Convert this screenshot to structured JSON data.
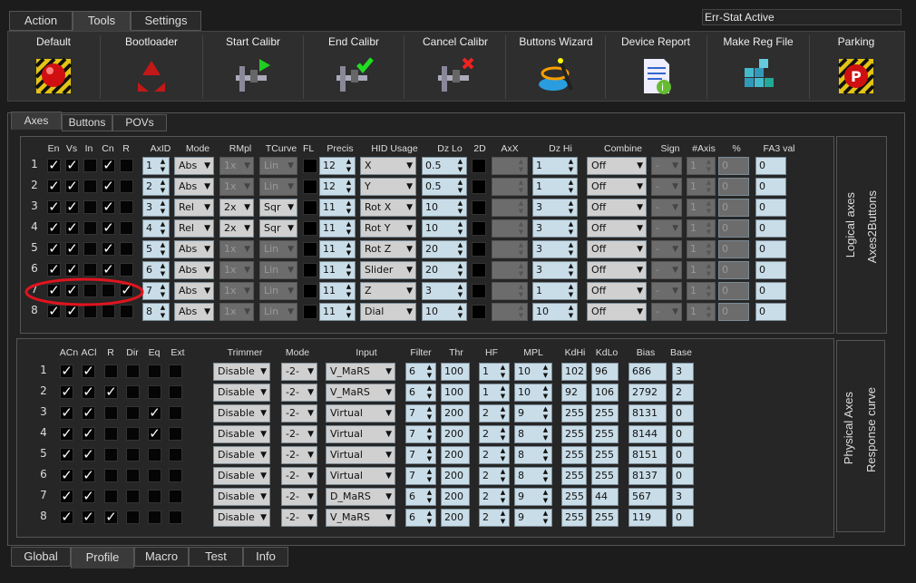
{
  "top_tabs": [
    "Action",
    "Tools",
    "Settings"
  ],
  "status": "Err-Stat Active",
  "toolbar": [
    {
      "label": "Default",
      "icon": "red-button-icon"
    },
    {
      "label": "Bootloader",
      "icon": "recycle-icon"
    },
    {
      "label": "Start Calibr",
      "icon": "caliper-play-icon"
    },
    {
      "label": "End Calibr",
      "icon": "caliper-check-icon"
    },
    {
      "label": "Cancel Calibr",
      "icon": "caliper-cancel-icon"
    },
    {
      "label": "Buttons Wizard",
      "icon": "wizard-icon"
    },
    {
      "label": "Device Report",
      "icon": "report-icon"
    },
    {
      "label": "Make Reg File",
      "icon": "registry-icon"
    },
    {
      "label": "Parking",
      "icon": "parking-icon"
    }
  ],
  "sub_tabs": [
    "Axes",
    "Buttons",
    "POVs"
  ],
  "logical_headers": [
    "En",
    "Vs",
    "In",
    "Cn",
    "R",
    "AxID",
    "Mode",
    "RMpl",
    "TCurve",
    "FL",
    "Precis",
    "HID Usage",
    "Dz Lo",
    "2D",
    "AxX",
    "Dz Hi",
    "Combine",
    "Sign",
    "#Axis",
    "%",
    "FA3 val"
  ],
  "logical_side": [
    "Logical axes",
    "Axes2Buttons"
  ],
  "logical_rows": [
    {
      "n": "1",
      "en": true,
      "vs": true,
      "in": false,
      "cn": true,
      "r": false,
      "axid": "1",
      "mode": "Abs",
      "rmpl": "1x",
      "tcurve": "Lin",
      "precis": "12",
      "hid": "X",
      "dzlo": "0.5",
      "dzhi": "1",
      "combine": "Off",
      "sign": "-",
      "naxis": "1",
      "pct": "0",
      "fa3": "0"
    },
    {
      "n": "2",
      "en": true,
      "vs": true,
      "in": false,
      "cn": true,
      "r": false,
      "axid": "2",
      "mode": "Abs",
      "rmpl": "1x",
      "tcurve": "Lin",
      "precis": "12",
      "hid": "Y",
      "dzlo": "0.5",
      "dzhi": "1",
      "combine": "Off",
      "sign": "-",
      "naxis": "1",
      "pct": "0",
      "fa3": "0"
    },
    {
      "n": "3",
      "en": true,
      "vs": true,
      "in": false,
      "cn": true,
      "r": false,
      "axid": "3",
      "mode": "Rel",
      "rmpl": "2x",
      "tcurve": "Sqr",
      "precis": "11",
      "hid": "Rot X",
      "dzlo": "10",
      "dzhi": "3",
      "combine": "Off",
      "sign": "-",
      "naxis": "1",
      "pct": "0",
      "fa3": "0"
    },
    {
      "n": "4",
      "en": true,
      "vs": true,
      "in": false,
      "cn": true,
      "r": false,
      "axid": "4",
      "mode": "Rel",
      "rmpl": "2x",
      "tcurve": "Sqr",
      "precis": "11",
      "hid": "Rot Y",
      "dzlo": "10",
      "dzhi": "3",
      "combine": "Off",
      "sign": "-",
      "naxis": "1",
      "pct": "0",
      "fa3": "0"
    },
    {
      "n": "5",
      "en": true,
      "vs": true,
      "in": false,
      "cn": true,
      "r": false,
      "axid": "5",
      "mode": "Abs",
      "rmpl": "1x",
      "tcurve": "Lin",
      "precis": "11",
      "hid": "Rot Z",
      "dzlo": "20",
      "dzhi": "3",
      "combine": "Off",
      "sign": "-",
      "naxis": "1",
      "pct": "0",
      "fa3": "0"
    },
    {
      "n": "6",
      "en": true,
      "vs": true,
      "in": false,
      "cn": true,
      "r": false,
      "axid": "6",
      "mode": "Abs",
      "rmpl": "1x",
      "tcurve": "Lin",
      "precis": "11",
      "hid": "Slider",
      "dzlo": "20",
      "dzhi": "3",
      "combine": "Off",
      "sign": "-",
      "naxis": "1",
      "pct": "0",
      "fa3": "0"
    },
    {
      "n": "7",
      "en": true,
      "vs": true,
      "in": false,
      "cn": false,
      "r": true,
      "axid": "7",
      "mode": "Abs",
      "rmpl": "1x",
      "tcurve": "Lin",
      "precis": "11",
      "hid": "Z",
      "dzlo": "3",
      "dzhi": "1",
      "combine": "Off",
      "sign": "-",
      "naxis": "1",
      "pct": "0",
      "fa3": "0"
    },
    {
      "n": "8",
      "en": true,
      "vs": true,
      "in": false,
      "cn": false,
      "r": false,
      "axid": "8",
      "mode": "Abs",
      "rmpl": "1x",
      "tcurve": "Lin",
      "precis": "11",
      "hid": "Dial",
      "dzlo": "10",
      "dzhi": "10",
      "combine": "Off",
      "sign": "-",
      "naxis": "1",
      "pct": "0",
      "fa3": "0"
    }
  ],
  "physical_headers": [
    "ACn",
    "ACl",
    "R",
    "Dir",
    "Eq",
    "Ext",
    "Trimmer",
    "Mode",
    "Input",
    "Filter",
    "Thr",
    "HF",
    "MPL",
    "KdHi",
    "KdLo",
    "Bias",
    "Base"
  ],
  "physical_side": [
    "Physical Axes",
    "Response curve"
  ],
  "physical_rows": [
    {
      "n": "1",
      "acn": true,
      "acl": true,
      "r": false,
      "dir": false,
      "eq": false,
      "ext": false,
      "trimmer": "Disable",
      "mode": "-2-",
      "input": "V_MaRS",
      "filter": "6",
      "thr": "100",
      "hf": "1",
      "mpl": "10",
      "kdhi": "102",
      "kdlo": "96",
      "bias": "686",
      "base": "3"
    },
    {
      "n": "2",
      "acn": true,
      "acl": true,
      "r": true,
      "dir": false,
      "eq": false,
      "ext": false,
      "trimmer": "Disable",
      "mode": "-2-",
      "input": "V_MaRS",
      "filter": "6",
      "thr": "100",
      "hf": "1",
      "mpl": "10",
      "kdhi": "92",
      "kdlo": "106",
      "bias": "2792",
      "base": "2"
    },
    {
      "n": "3",
      "acn": true,
      "acl": true,
      "r": false,
      "dir": false,
      "eq": true,
      "ext": false,
      "trimmer": "Disable",
      "mode": "-2-",
      "input": "Virtual",
      "filter": "7",
      "thr": "200",
      "hf": "2",
      "mpl": "9",
      "kdhi": "255",
      "kdlo": "255",
      "bias": "8131",
      "base": "0"
    },
    {
      "n": "4",
      "acn": true,
      "acl": true,
      "r": false,
      "dir": false,
      "eq": true,
      "ext": false,
      "trimmer": "Disable",
      "mode": "-2-",
      "input": "Virtual",
      "filter": "7",
      "thr": "200",
      "hf": "2",
      "mpl": "8",
      "kdhi": "255",
      "kdlo": "255",
      "bias": "8144",
      "base": "0"
    },
    {
      "n": "5",
      "acn": true,
      "acl": true,
      "r": false,
      "dir": false,
      "eq": false,
      "ext": false,
      "trimmer": "Disable",
      "mode": "-2-",
      "input": "Virtual",
      "filter": "7",
      "thr": "200",
      "hf": "2",
      "mpl": "8",
      "kdhi": "255",
      "kdlo": "255",
      "bias": "8151",
      "base": "0"
    },
    {
      "n": "6",
      "acn": true,
      "acl": true,
      "r": false,
      "dir": false,
      "eq": false,
      "ext": false,
      "trimmer": "Disable",
      "mode": "-2-",
      "input": "Virtual",
      "filter": "7",
      "thr": "200",
      "hf": "2",
      "mpl": "8",
      "kdhi": "255",
      "kdlo": "255",
      "bias": "8137",
      "base": "0"
    },
    {
      "n": "7",
      "acn": true,
      "acl": true,
      "r": false,
      "dir": false,
      "eq": false,
      "ext": false,
      "trimmer": "Disable",
      "mode": "-2-",
      "input": "D_MaRS",
      "filter": "6",
      "thr": "200",
      "hf": "2",
      "mpl": "9",
      "kdhi": "255",
      "kdlo": "44",
      "bias": "567",
      "base": "3"
    },
    {
      "n": "8",
      "acn": true,
      "acl": true,
      "r": true,
      "dir": false,
      "eq": false,
      "ext": false,
      "trimmer": "Disable",
      "mode": "-2-",
      "input": "V_MaRS",
      "filter": "6",
      "thr": "200",
      "hf": "2",
      "mpl": "9",
      "kdhi": "255",
      "kdlo": "255",
      "bias": "119",
      "base": "0"
    }
  ],
  "bottom_tabs": [
    "Global",
    "Profile",
    "Macro",
    "Test",
    "Info"
  ],
  "colors": {
    "field": "#c9dde8",
    "annotation": "#e0141e"
  }
}
